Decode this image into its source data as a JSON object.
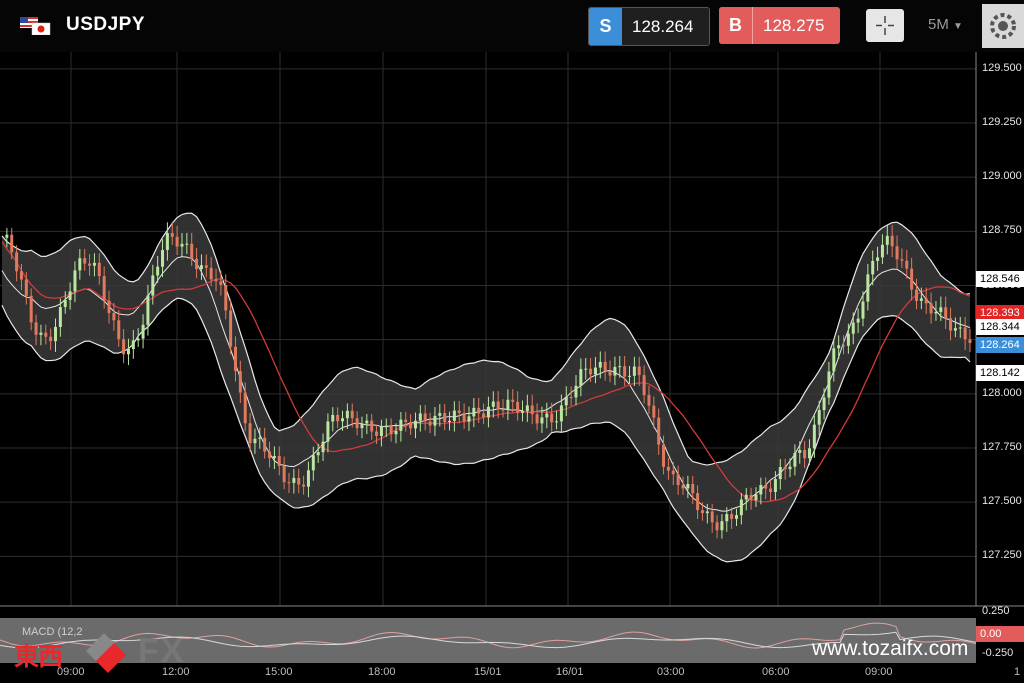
{
  "header": {
    "symbol": "USDJPY",
    "flag_icon": "us-jp-flag-icon",
    "sell": {
      "tag": "S",
      "price": "128.264"
    },
    "buy": {
      "tag": "B",
      "price": "128.275"
    },
    "timeframe": "5M"
  },
  "price_axis": {
    "ticks": [
      "129.500",
      "129.250",
      "129.000",
      "128.750",
      "128.500",
      "128.000",
      "127.750",
      "127.500",
      "127.250"
    ],
    "tags": [
      {
        "value": "128.546",
        "bg": "#ffffff",
        "fg": "#000000"
      },
      {
        "value": "128.393",
        "bg": "#e32424",
        "fg": "#ffffff"
      },
      {
        "value": "128.344",
        "bg": "#ffffff",
        "fg": "#000000"
      },
      {
        "value": "128.264",
        "bg": "#3c8ed8",
        "fg": "#ffffff"
      },
      {
        "value": "128.142",
        "bg": "#ffffff",
        "fg": "#000000"
      }
    ]
  },
  "macd": {
    "label": "MACD (12,2",
    "upper": "0.250",
    "current": "0.00",
    "lower": "-0.250"
  },
  "time_axis": [
    "09:00",
    "12:00",
    "15:00",
    "18:00",
    "15/01",
    "16/01",
    "03:00",
    "06:00",
    "09:00",
    "1"
  ],
  "watermark": {
    "kanji": "東西",
    "fx": "FX",
    "url": "www.tozaifx.com"
  },
  "chart_data": {
    "type": "candlestick",
    "title": "USDJPY",
    "timeframe": "5M",
    "ylim": [
      127.15,
      129.55
    ],
    "grid": true,
    "x": [
      "09:00",
      "12:00",
      "15:00",
      "18:00",
      "15/01",
      "16/01",
      "03:00",
      "06:00",
      "09:00"
    ],
    "close": [
      128.72,
      128.25,
      128.62,
      128.2,
      128.72,
      128.55,
      127.78,
      127.58,
      127.9,
      127.83,
      127.88,
      127.9,
      127.95,
      127.88,
      128.12,
      128.1,
      127.6,
      127.4,
      127.55,
      127.72,
      128.25,
      128.7,
      128.4,
      128.26
    ],
    "indicators": [
      "Bollinger Bands (white)",
      "Moving Average (red)"
    ]
  }
}
